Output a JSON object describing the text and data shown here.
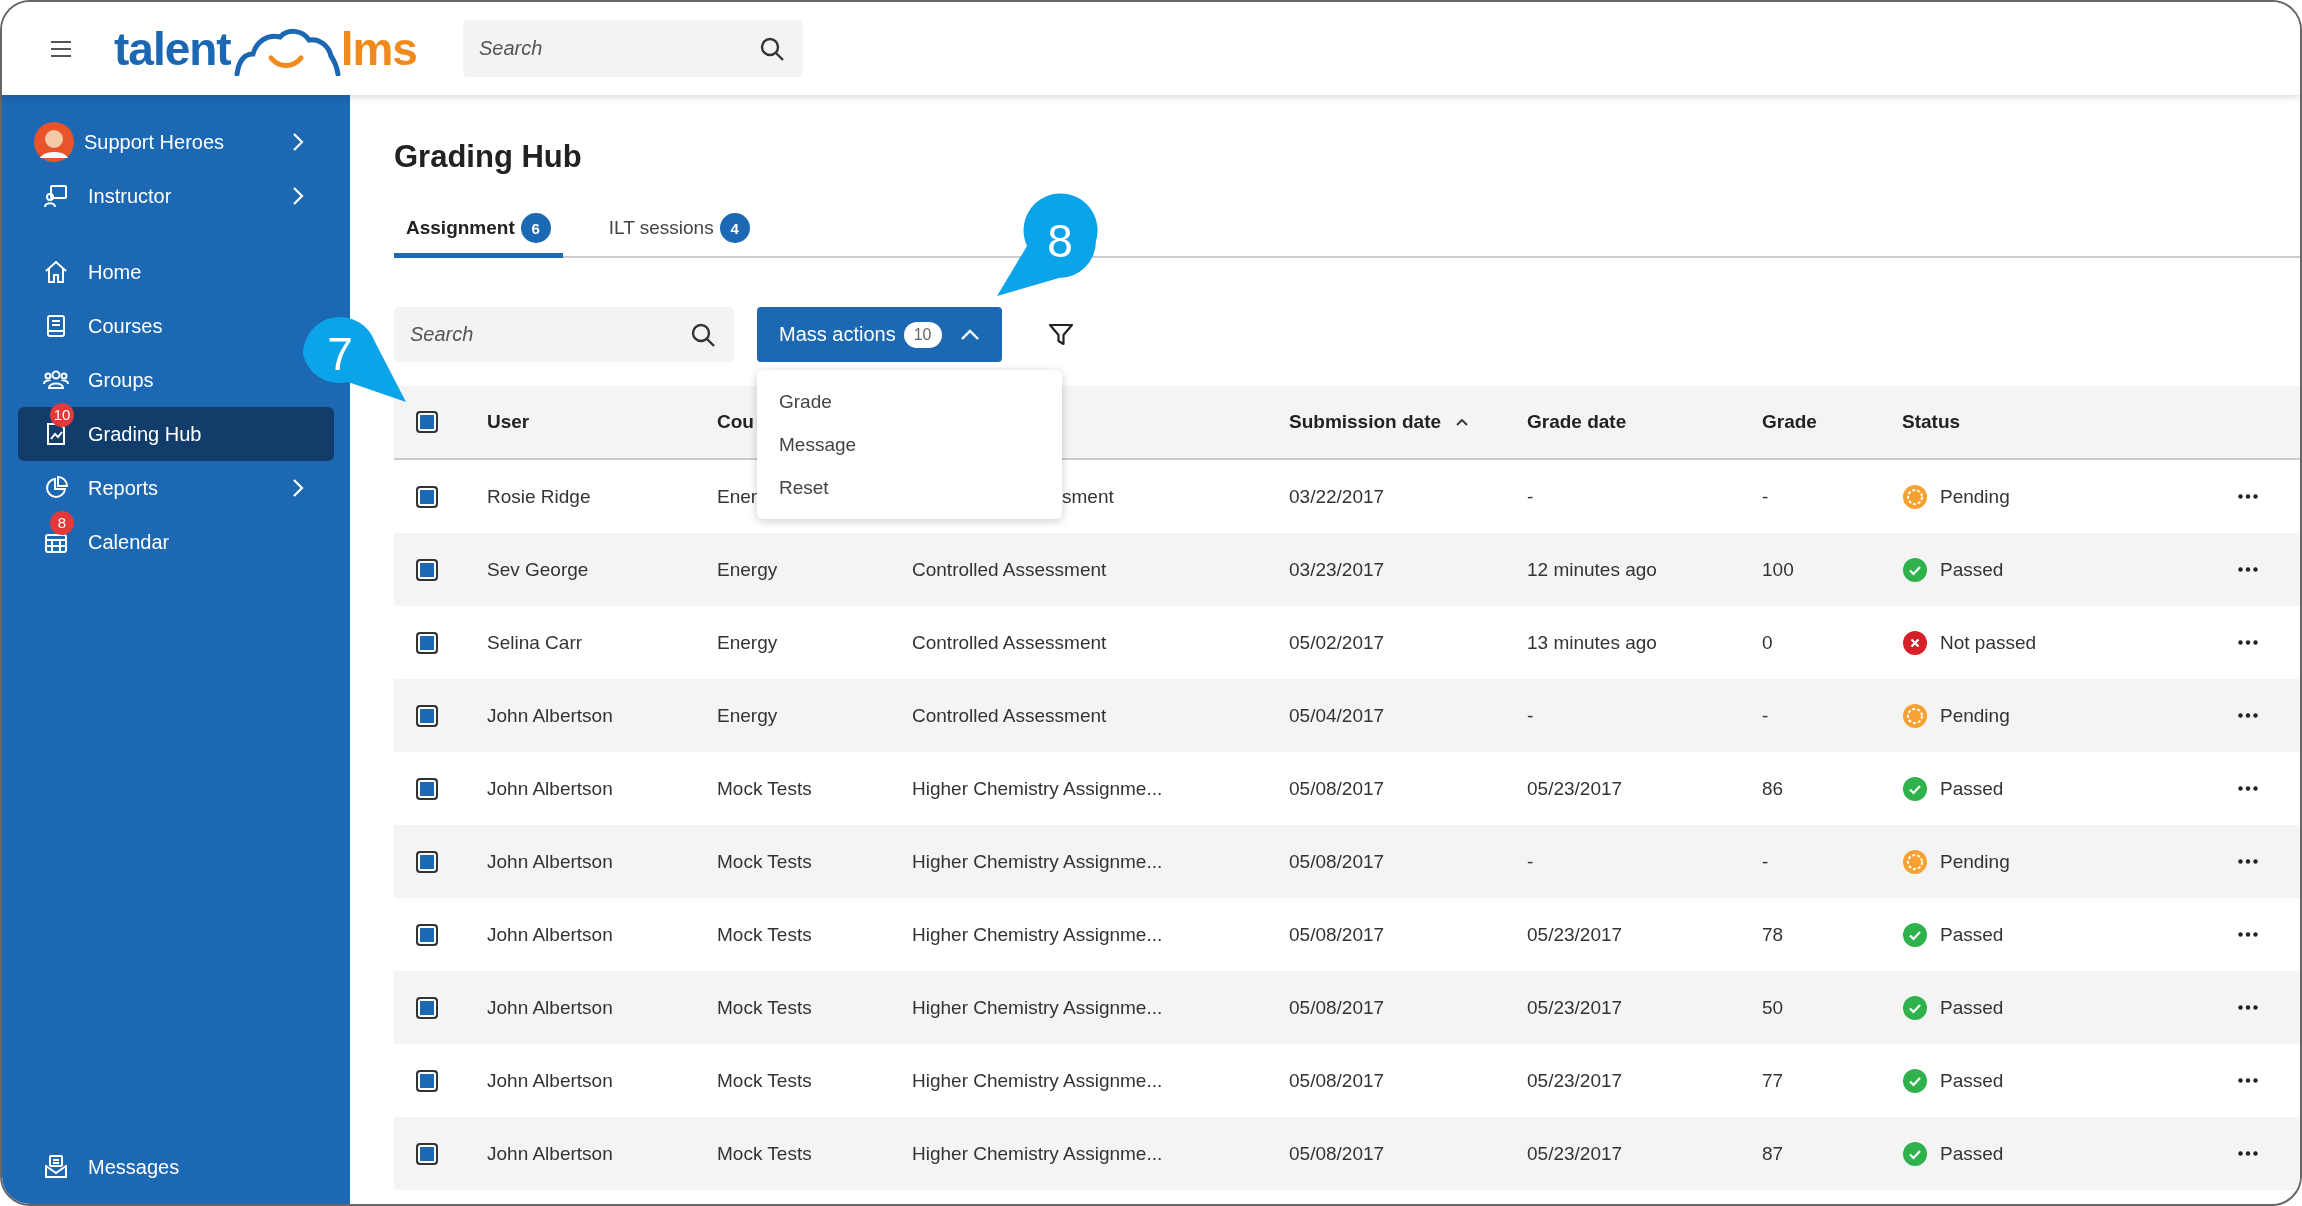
{
  "header": {
    "logo": {
      "text_1": "talent",
      "text_2": "lms"
    },
    "search": {
      "placeholder": "Search"
    }
  },
  "sidebar": {
    "profile": {
      "name": "Support Heroes",
      "submenu": true
    },
    "items": [
      {
        "label": "Instructor",
        "submenu": true,
        "selected": false
      },
      {
        "label": "Home",
        "submenu": false,
        "selected": false
      },
      {
        "label": "Courses",
        "submenu": false,
        "selected": false
      },
      {
        "label": "Groups",
        "submenu": false,
        "selected": false
      },
      {
        "label": "Grading Hub",
        "submenu": false,
        "selected": true,
        "badge": "10"
      },
      {
        "label": "Reports",
        "submenu": true,
        "selected": false
      },
      {
        "label": "Calendar",
        "submenu": false,
        "selected": false,
        "badge": "8"
      }
    ],
    "bottom_item": {
      "label": "Messages"
    }
  },
  "page": {
    "title": "Grading Hub",
    "tabs": [
      {
        "label": "Assignment",
        "count": "6",
        "selected": true
      },
      {
        "label": "ILT sessions",
        "count": "4",
        "selected": false
      }
    ],
    "search": {
      "placeholder": "Search"
    },
    "mass_actions": {
      "label": "Mass actions",
      "count": "10",
      "expanded": true,
      "menu": [
        "Grade",
        "Message",
        "Reset"
      ]
    },
    "callouts": [
      "7",
      "8"
    ],
    "table": {
      "select_all_checked": true,
      "columns": [
        {
          "label": "User"
        },
        {
          "label": "Cou"
        },
        {},
        {
          "label": "Submission date",
          "sort_ascending": true
        },
        {
          "label": "Grade date"
        },
        {
          "label": "Grade"
        },
        {
          "label": "Status"
        }
      ],
      "rows": [
        {
          "checked": true,
          "user": "Rosie Ridge",
          "course": "Ener",
          "assignment": "sment",
          "submission": "03/22/2017",
          "grade_date": "-",
          "grade": "-",
          "status": "Pending",
          "kind": "pending"
        },
        {
          "checked": true,
          "user": "Sev George",
          "course": "Energy",
          "assignment": "Controlled Assessment",
          "submission": "03/23/2017",
          "grade_date": "12 minutes ago",
          "grade": "100",
          "status": "Passed",
          "kind": "passed"
        },
        {
          "checked": true,
          "user": "Selina Carr",
          "course": "Energy",
          "assignment": "Controlled Assessment",
          "submission": "05/02/2017",
          "grade_date": "13 minutes ago",
          "grade": "0",
          "status": "Not passed",
          "kind": "failed"
        },
        {
          "checked": true,
          "user": "John Albertson",
          "course": "Energy",
          "assignment": "Controlled Assessment",
          "submission": "05/04/2017",
          "grade_date": "-",
          "grade": "-",
          "status": "Pending",
          "kind": "pending"
        },
        {
          "checked": true,
          "user": "John Albertson",
          "course": "Mock Tests",
          "assignment": "Higher Chemistry Assignme...",
          "submission": "05/08/2017",
          "grade_date": "05/23/2017",
          "grade": "86",
          "status": "Passed",
          "kind": "passed"
        },
        {
          "checked": true,
          "user": "John Albertson",
          "course": "Mock Tests",
          "assignment": "Higher Chemistry Assignme...",
          "submission": "05/08/2017",
          "grade_date": "-",
          "grade": "-",
          "status": "Pending",
          "kind": "pending"
        },
        {
          "checked": true,
          "user": "John Albertson",
          "course": "Mock Tests",
          "assignment": "Higher Chemistry Assignme...",
          "submission": "05/08/2017",
          "grade_date": "05/23/2017",
          "grade": "78",
          "status": "Passed",
          "kind": "passed"
        },
        {
          "checked": true,
          "user": "John Albertson",
          "course": "Mock Tests",
          "assignment": "Higher Chemistry Assignme...",
          "submission": "05/08/2017",
          "grade_date": "05/23/2017",
          "grade": "50",
          "status": "Passed",
          "kind": "passed"
        },
        {
          "checked": true,
          "user": "John Albertson",
          "course": "Mock Tests",
          "assignment": "Higher Chemistry Assignme...",
          "submission": "05/08/2017",
          "grade_date": "05/23/2017",
          "grade": "77",
          "status": "Passed",
          "kind": "passed"
        },
        {
          "checked": true,
          "user": "John Albertson",
          "course": "Mock Tests",
          "assignment": "Higher Chemistry Assignme...",
          "submission": "05/08/2017",
          "grade_date": "05/23/2017",
          "grade": "87",
          "status": "Passed",
          "kind": "passed"
        }
      ]
    }
  }
}
